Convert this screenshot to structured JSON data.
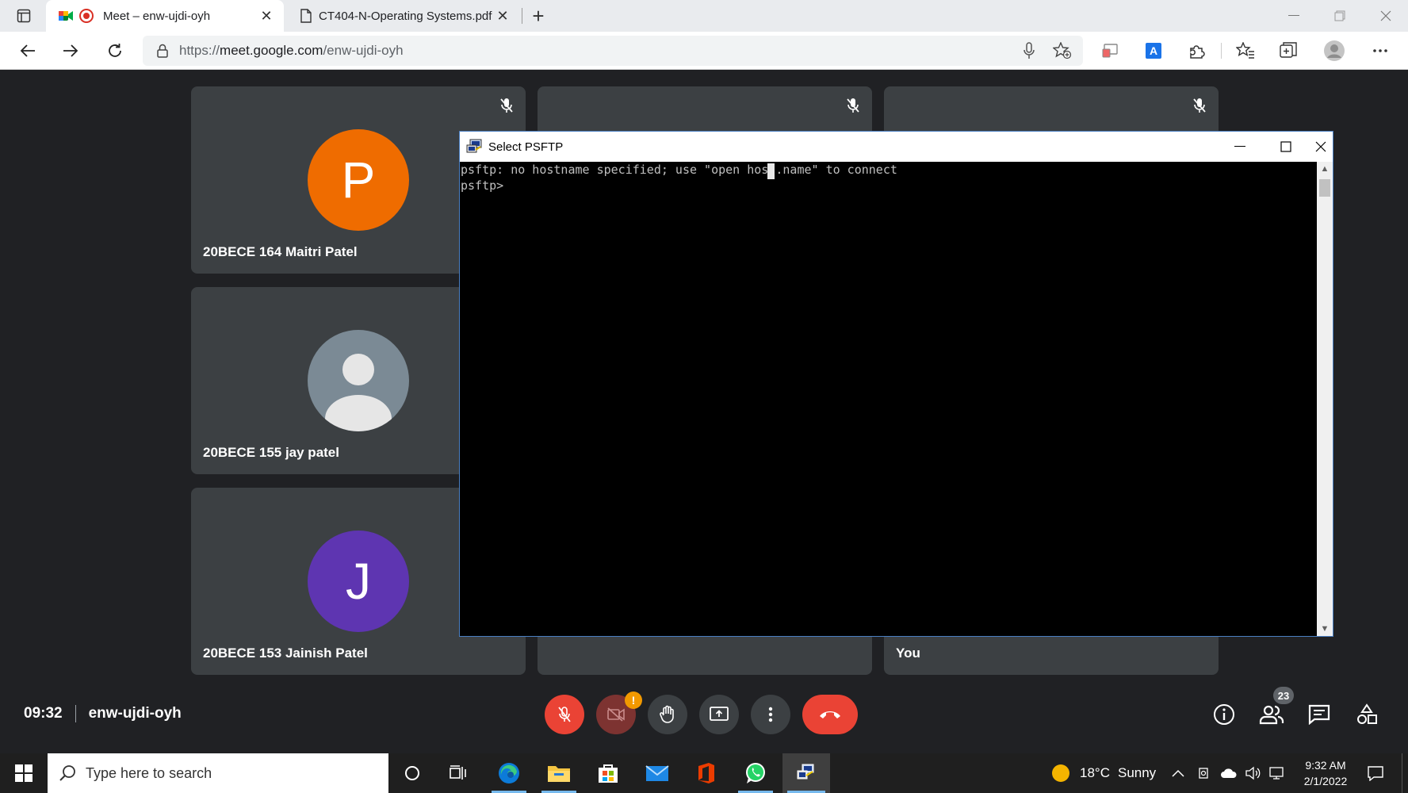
{
  "browser": {
    "tabs": [
      {
        "title": "Meet – enw-ujdi-oyh",
        "active": true
      },
      {
        "title": "CT404-N-Operating Systems.pdf",
        "active": false
      }
    ],
    "url_prefix": "https://",
    "url_host": "meet.google.com",
    "url_path": "/enw-ujdi-oyh"
  },
  "meet": {
    "participants": [
      {
        "name": "20BECE 164 Maitri Patel",
        "initial": "P",
        "color": "#ef6c00"
      },
      {
        "name": "20BECE 155 jay patel",
        "initial": "",
        "color": "#7b8a95"
      },
      {
        "name": "20BECE 153 Jainish Patel",
        "initial": "J",
        "color": "#5e35b1"
      },
      {
        "name": "You",
        "initial": "",
        "color": ""
      }
    ],
    "time": "09:32",
    "meeting_code": "enw-ujdi-oyh",
    "people_count": "23",
    "camera_warning": "!"
  },
  "console": {
    "title": "Select PSFTP",
    "lines": [
      "psftp: no hostname specified; use \"open host.name\" to connect",
      "psftp>"
    ]
  },
  "taskbar": {
    "search_placeholder": "Type here to search",
    "weather_temp": "18°C",
    "weather_text": "Sunny",
    "time": "9:32 AM",
    "date": "2/1/2022"
  }
}
